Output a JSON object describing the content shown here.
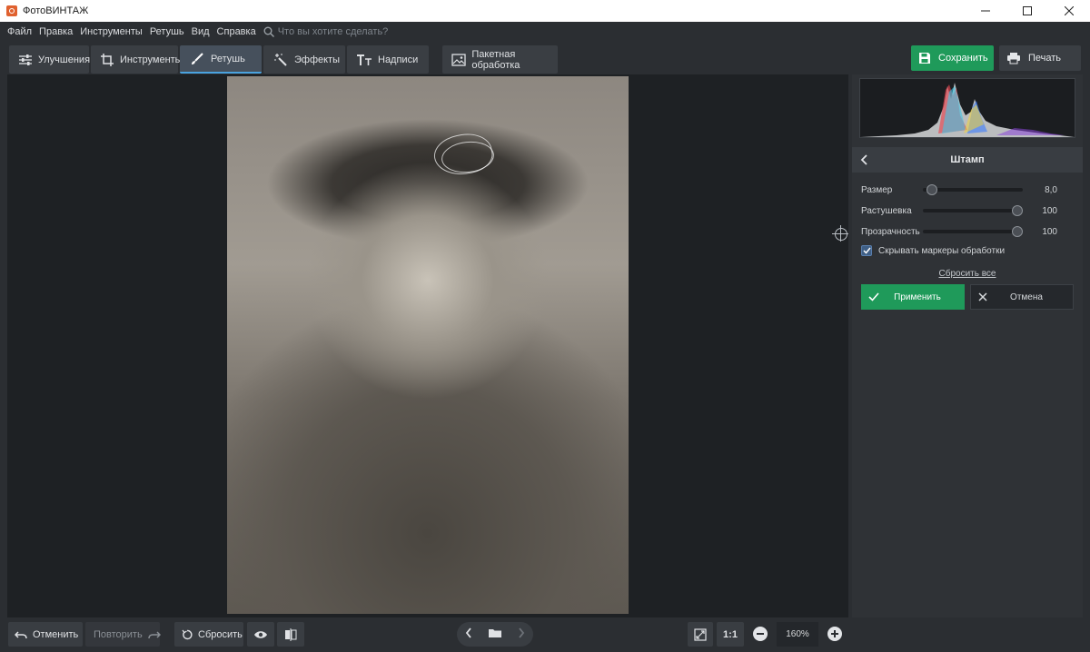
{
  "window": {
    "title": "ФотоВИНТАЖ",
    "controls": [
      "minimize",
      "maximize",
      "close"
    ]
  },
  "menu": {
    "items": [
      "Файл",
      "Правка",
      "Инструменты",
      "Ретушь",
      "Вид",
      "Справка"
    ],
    "search_placeholder": "Что вы хотите сделать?"
  },
  "tabs": [
    {
      "label": "Улучшения",
      "icon": "sliders-icon"
    },
    {
      "label": "Инструменты",
      "icon": "crop-icon"
    },
    {
      "label": "Ретушь",
      "icon": "brush-icon",
      "active": true
    },
    {
      "label": "Эффекты",
      "icon": "magic-wand-icon"
    },
    {
      "label": "Надписи",
      "icon": "text-icon"
    },
    {
      "label": "Пакетная обработка",
      "icon": "images-icon"
    }
  ],
  "toolbar": {
    "save_label": "Сохранить",
    "print_label": "Печать"
  },
  "panel": {
    "title": "Штамп",
    "sliders": [
      {
        "label": "Размер",
        "value": "8,0",
        "fraction": 0.04
      },
      {
        "label": "Растушевка",
        "value": "100",
        "fraction": 1.0
      },
      {
        "label": "Прозрачность",
        "value": "100",
        "fraction": 1.0
      }
    ],
    "hide_markers": {
      "label": "Скрывать маркеры обработки",
      "checked": true
    },
    "reset_all": "Сбросить все",
    "apply": "Применить",
    "cancel": "Отмена"
  },
  "bottom": {
    "undo": "Отменить",
    "redo": "Повторить",
    "reset": "Сбросить",
    "ratio": "1:1",
    "zoom": "160%"
  },
  "colors": {
    "accent_green": "#1f9a5a",
    "active_tab_underline": "#4aa3df",
    "background": "#2b2e32"
  }
}
